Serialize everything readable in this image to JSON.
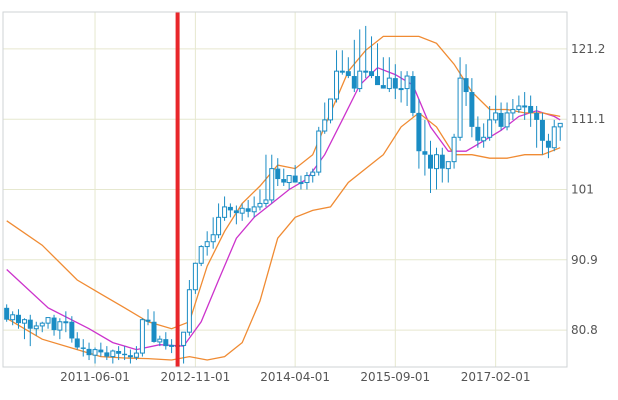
{
  "chart_data": {
    "type": "candlestick",
    "title": "",
    "xlabel": "",
    "ylabel": "",
    "y_axis_position": "right",
    "ylim": [
      75.5,
      126.5
    ],
    "y_ticks": [
      80.8,
      90.9,
      101,
      111.1,
      121.2
    ],
    "x_ticks": [
      "2011-06-01",
      "2012-11-01",
      "2014-04-01",
      "2015-09-01",
      "2017-02-01"
    ],
    "grid": true,
    "marker": {
      "date": "2012-08-01"
    },
    "colors": {
      "candle": "#1a8cc4",
      "sma": "#cc33cc",
      "bands": "#f08b33",
      "marker": "#e8262a",
      "grid": "#e6e8cf",
      "border": "#cfd3d6"
    },
    "series": [
      {
        "name": "",
        "type": "candle",
        "x": [
          "2010-03-01",
          "2010-04-01",
          "2010-05-01",
          "2010-06-01",
          "2010-07-01",
          "2010-08-01",
          "2010-09-01",
          "2010-10-01",
          "2010-11-01",
          "2010-12-01",
          "2011-01-01",
          "2011-02-01",
          "2011-03-01",
          "2011-04-01",
          "2011-05-01",
          "2011-06-01",
          "2011-07-01",
          "2011-08-01",
          "2011-09-01",
          "2011-10-01",
          "2011-11-01",
          "2011-12-01",
          "2012-01-01",
          "2012-02-01",
          "2012-03-01",
          "2012-04-01",
          "2012-05-01",
          "2012-06-01",
          "2012-07-01",
          "2012-08-01",
          "2012-09-01",
          "2012-10-01",
          "2012-11-01",
          "2012-12-01",
          "2013-01-01",
          "2013-02-01",
          "2013-03-01",
          "2013-04-01",
          "2013-05-01",
          "2013-06-01",
          "2013-07-01",
          "2013-08-01",
          "2013-09-01",
          "2013-10-01",
          "2013-11-01",
          "2013-12-01",
          "2014-01-01",
          "2014-02-01",
          "2014-03-01",
          "2014-04-01",
          "2014-05-01",
          "2014-06-01",
          "2014-07-01",
          "2014-08-01",
          "2014-09-01",
          "2014-10-01",
          "2014-11-01",
          "2014-12-01",
          "2015-01-01",
          "2015-02-01",
          "2015-03-01",
          "2015-04-01",
          "2015-05-01",
          "2015-06-01",
          "2015-07-01",
          "2015-08-01",
          "2015-09-01",
          "2015-10-01",
          "2015-11-01",
          "2015-12-01",
          "2016-01-01",
          "2016-02-01",
          "2016-03-01",
          "2016-04-01",
          "2016-05-01",
          "2016-06-01",
          "2016-07-01",
          "2016-08-01",
          "2016-09-01",
          "2016-10-01",
          "2016-11-01",
          "2016-12-01",
          "2017-01-01",
          "2017-02-01",
          "2017-03-01",
          "2017-04-01",
          "2017-05-01",
          "2017-06-01",
          "2017-07-01",
          "2017-08-01",
          "2017-09-01",
          "2017-10-01",
          "2017-11-01",
          "2017-12-01",
          "2018-01-01"
        ],
        "open": [
          84.0,
          82.3,
          83.0,
          81.8,
          82.3,
          81.0,
          81.4,
          81.8,
          82.6,
          80.8,
          82.0,
          82.0,
          79.6,
          78.3,
          78.1,
          77.2,
          78.0,
          77.6,
          77.0,
          77.8,
          77.4,
          77.2,
          76.9,
          77.5,
          82.3,
          82.0,
          79.1,
          79.5,
          78.5,
          78.6,
          78.6,
          80.5,
          86.6,
          90.4,
          92.8,
          93.5,
          94.5,
          97.0,
          98.5,
          98.0,
          97.6,
          98.3,
          97.8,
          98.5,
          99.0,
          99.5,
          104.0,
          102.5,
          102.0,
          103.0,
          102.0,
          102.0,
          103.0,
          103.5,
          109.4,
          111.0,
          114.0,
          118.0,
          118.0,
          117.3,
          115.5,
          118.0,
          118.0,
          117.3,
          116.0,
          115.5,
          117.0,
          115.5,
          115.5,
          117.3,
          112.0,
          106.5,
          106.0,
          104.0,
          106.0,
          104.0,
          105.0,
          108.5,
          117.0,
          115.0,
          110.0,
          108.0,
          108.5,
          111.0,
          112.0,
          110.0,
          112.0,
          112.5,
          113.0,
          113.0,
          112.0,
          111.0,
          108.0,
          107.0,
          110.0
        ],
        "high": [
          84.5,
          83.5,
          83.8,
          82.5,
          83.0,
          82.0,
          82.0,
          82.5,
          83.0,
          82.5,
          83.5,
          82.8,
          80.5,
          79.5,
          79.0,
          78.3,
          79.0,
          78.5,
          78.0,
          78.5,
          78.5,
          78.0,
          78.5,
          82.5,
          83.8,
          83.5,
          80.0,
          80.5,
          79.5,
          79.5,
          80.5,
          88.0,
          90.5,
          93.0,
          95.0,
          97.0,
          99.0,
          100.0,
          99.0,
          98.7,
          99.0,
          99.5,
          100.0,
          101.0,
          106.0,
          106.0,
          105.5,
          104.0,
          103.0,
          104.5,
          103.0,
          103.5,
          104.0,
          110.0,
          113.5,
          114.0,
          121.0,
          121.0,
          120.0,
          122.5,
          124.0,
          124.5,
          123.0,
          122.0,
          120.0,
          120.0,
          119.0,
          118.0,
          118.0,
          118.0,
          114.0,
          111.0,
          108.0,
          107.0,
          107.0,
          105.0,
          109.0,
          120.0,
          119.0,
          117.0,
          111.5,
          110.5,
          113.0,
          114.5,
          113.5,
          113.5,
          114.0,
          114.5,
          115.0,
          114.5,
          113.0,
          112.0,
          109.0,
          111.0,
          110.5
        ],
        "low": [
          82.0,
          81.5,
          81.0,
          79.5,
          78.5,
          80.0,
          80.5,
          81.0,
          80.0,
          79.5,
          80.5,
          79.0,
          78.0,
          77.0,
          76.5,
          76.0,
          77.0,
          76.5,
          76.0,
          76.5,
          76.5,
          76.0,
          76.5,
          77.0,
          81.5,
          79.0,
          78.5,
          78.0,
          77.5,
          77.5,
          76.0,
          80.0,
          86.0,
          90.0,
          91.5,
          92.5,
          94.0,
          96.5,
          97.0,
          96.0,
          96.5,
          97.0,
          97.0,
          98.0,
          98.5,
          99.0,
          101.5,
          101.5,
          101.0,
          102.0,
          101.0,
          101.0,
          102.0,
          103.0,
          109.0,
          110.5,
          113.5,
          117.5,
          117.0,
          115.0,
          115.0,
          117.0,
          117.0,
          116.5,
          115.5,
          115.0,
          114.0,
          113.5,
          113.0,
          111.5,
          104.0,
          103.0,
          100.5,
          101.0,
          102.0,
          102.0,
          104.0,
          108.0,
          113.0,
          108.5,
          107.0,
          107.0,
          108.0,
          110.5,
          109.5,
          109.5,
          111.0,
          112.0,
          111.0,
          110.0,
          107.0,
          106.0,
          105.5,
          106.5,
          108.0
        ],
        "close": [
          82.3,
          83.0,
          81.8,
          82.3,
          81.0,
          81.4,
          81.8,
          82.6,
          80.8,
          82.0,
          82.0,
          79.6,
          78.3,
          78.1,
          77.2,
          78.0,
          77.6,
          77.0,
          77.8,
          77.4,
          77.2,
          76.9,
          77.5,
          82.3,
          82.0,
          79.1,
          79.5,
          78.5,
          78.6,
          78.6,
          80.5,
          86.6,
          90.4,
          92.8,
          93.5,
          94.5,
          97.0,
          98.5,
          98.0,
          97.6,
          98.3,
          97.8,
          98.5,
          99.0,
          99.5,
          104.0,
          102.5,
          102.0,
          103.0,
          102.0,
          102.0,
          103.0,
          103.5,
          109.4,
          111.0,
          114.0,
          118.0,
          118.0,
          117.3,
          115.5,
          118.0,
          118.0,
          117.3,
          116.0,
          115.5,
          117.0,
          115.5,
          115.5,
          117.3,
          112.0,
          106.5,
          106.0,
          104.0,
          106.0,
          104.0,
          105.0,
          108.5,
          117.0,
          115.0,
          110.0,
          108.0,
          108.5,
          111.0,
          112.0,
          110.0,
          112.0,
          112.5,
          113.0,
          113.0,
          112.0,
          111.0,
          108.0,
          107.0,
          110.0,
          110.5
        ]
      },
      {
        "name": "",
        "type": "line",
        "role": "sma",
        "x": [
          "2010-03-01",
          "2010-10-01",
          "2011-05-01",
          "2011-09-01",
          "2012-01-01",
          "2012-05-01",
          "2012-09-01",
          "2012-12-01",
          "2013-03-01",
          "2013-06-01",
          "2013-09-01",
          "2013-12-01",
          "2014-03-01",
          "2014-06-01",
          "2014-09-01",
          "2014-12-01",
          "2015-03-01",
          "2015-06-01",
          "2015-09-01",
          "2015-12-01",
          "2016-03-01",
          "2016-06-01",
          "2016-09-01",
          "2016-12-01",
          "2017-03-01",
          "2017-06-01",
          "2017-09-01",
          "2017-12-01",
          "2018-01-01"
        ],
        "y": [
          89.5,
          84.0,
          81.0,
          79.0,
          78.0,
          78.7,
          78.5,
          82.0,
          88.0,
          94.0,
          97.0,
          99.0,
          101.0,
          102.5,
          106.0,
          111.0,
          116.0,
          118.5,
          117.5,
          116.0,
          110.0,
          106.5,
          106.5,
          108.0,
          109.5,
          111.5,
          112.3,
          111.5,
          111.0
        ]
      },
      {
        "name": "",
        "type": "line",
        "role": "upper-band",
        "x": [
          "2010-03-01",
          "2010-09-01",
          "2011-03-01",
          "2011-07-01",
          "2011-11-01",
          "2012-03-01",
          "2012-07-01",
          "2012-10-01",
          "2013-01-01",
          "2013-04-01",
          "2013-07-01",
          "2013-10-01",
          "2014-01-01",
          "2014-04-01",
          "2014-07-01",
          "2014-10-01",
          "2015-01-01",
          "2015-04-01",
          "2015-07-01",
          "2015-10-01",
          "2016-01-01",
          "2016-04-01",
          "2016-07-01",
          "2016-10-01",
          "2017-01-01",
          "2017-04-01",
          "2017-07-01",
          "2017-10-01",
          "2018-01-01"
        ],
        "y": [
          96.5,
          93.0,
          88.0,
          86.0,
          84.0,
          82.0,
          81.0,
          82.0,
          90.0,
          95.0,
          99.0,
          101.5,
          104.5,
          104.0,
          106.0,
          112.0,
          118.0,
          121.0,
          123.0,
          123.0,
          123.0,
          122.0,
          119.0,
          115.0,
          112.5,
          112.5,
          112.0,
          112.0,
          111.5
        ]
      },
      {
        "name": "",
        "type": "line",
        "role": "lower-band",
        "x": [
          "2010-03-01",
          "2010-09-01",
          "2011-03-01",
          "2011-07-01",
          "2011-11-01",
          "2012-03-01",
          "2012-07-01",
          "2012-10-01",
          "2013-01-01",
          "2013-04-01",
          "2013-07-01",
          "2013-10-01",
          "2014-01-01",
          "2014-04-01",
          "2014-07-01",
          "2014-10-01",
          "2015-01-01",
          "2015-04-01",
          "2015-07-01",
          "2015-10-01",
          "2016-01-01",
          "2016-04-01",
          "2016-07-01",
          "2016-10-01",
          "2017-01-01",
          "2017-04-01",
          "2017-07-01",
          "2017-10-01",
          "2018-01-01"
        ],
        "y": [
          82.5,
          79.5,
          78.0,
          77.0,
          76.8,
          76.7,
          76.5,
          77.0,
          76.5,
          77.0,
          79.0,
          85.0,
          94.0,
          97.0,
          98.0,
          98.5,
          102.0,
          104.0,
          106.0,
          110.0,
          112.0,
          110.0,
          106.0,
          106.0,
          105.5,
          105.5,
          106.0,
          106.0,
          107.0
        ]
      }
    ]
  }
}
